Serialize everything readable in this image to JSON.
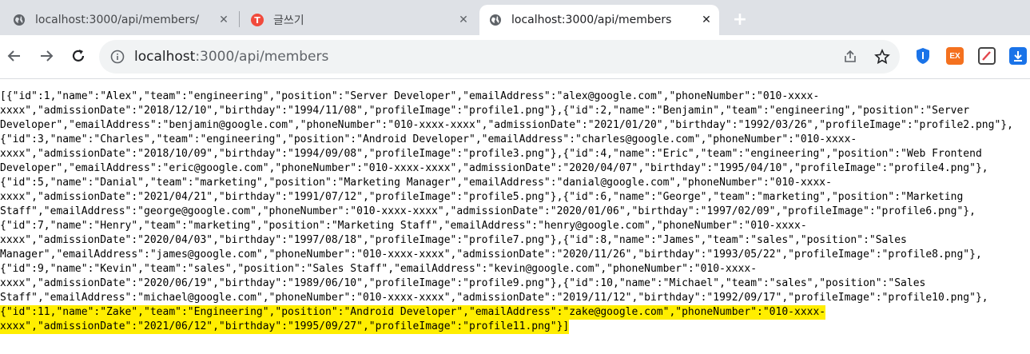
{
  "tabs": [
    {
      "title": "localhost:3000/api/members/",
      "favicon": "globe-icon",
      "active": false
    },
    {
      "title": "글쓰기",
      "favicon": "tistory-icon",
      "active": false
    },
    {
      "title": "localhost:3000/api/members",
      "favicon": "globe-icon",
      "active": true
    }
  ],
  "toolbar": {
    "url_host": "localhost",
    "url_path": ":3000/api/members"
  },
  "extensions": [
    {
      "name": "shield-extension",
      "color": "#1a73e8",
      "label": ""
    },
    {
      "name": "ex-extension",
      "color": "#f4711f",
      "label": "EX"
    },
    {
      "name": "pen-extension",
      "color": "#444444",
      "label": ""
    },
    {
      "name": "download-extension",
      "color": "#1a73e8",
      "label": ""
    }
  ],
  "colors": {
    "highlight": "#ffee00",
    "tab_strip": "#dee1e6"
  },
  "content": {
    "lines": [
      "[{\"id\":1,\"name\":\"Alex\",\"team\":\"engineering\",\"position\":\"Server Developer\",\"emailAddress\":\"alex@google.com\",\"phoneNumber\":\"010-xxxx-",
      "xxxx\",\"admissionDate\":\"2018/12/10\",\"birthday\":\"1994/11/08\",\"profileImage\":\"profile1.png\"},{\"id\":2,\"name\":\"Benjamin\",\"team\":\"engineering\",\"position\":\"Server",
      "Developer\",\"emailAddress\":\"benjamin@google.com\",\"phoneNumber\":\"010-xxxx-xxxx\",\"admissionDate\":\"2021/01/20\",\"birthday\":\"1992/03/26\",\"profileImage\":\"profile2.png\"},",
      "{\"id\":3,\"name\":\"Charles\",\"team\":\"engineering\",\"position\":\"Android Developer\",\"emailAddress\":\"charles@google.com\",\"phoneNumber\":\"010-xxxx-",
      "xxxx\",\"admissionDate\":\"2018/10/09\",\"birthday\":\"1994/09/08\",\"profileImage\":\"profile3.png\"},{\"id\":4,\"name\":\"Eric\",\"team\":\"engineering\",\"position\":\"Web Frontend",
      "Developer\",\"emailAddress\":\"eric@google.com\",\"phoneNumber\":\"010-xxxx-xxxx\",\"admissionDate\":\"2020/04/07\",\"birthday\":\"1995/04/10\",\"profileImage\":\"profile4.png\"},",
      "{\"id\":5,\"name\":\"Danial\",\"team\":\"marketing\",\"position\":\"Marketing Manager\",\"emailAddress\":\"danial@google.com\",\"phoneNumber\":\"010-xxxx-",
      "xxxx\",\"admissionDate\":\"2021/04/21\",\"birthday\":\"1991/07/12\",\"profileImage\":\"profile5.png\"},{\"id\":6,\"name\":\"George\",\"team\":\"marketing\",\"position\":\"Marketing",
      "Staff\",\"emailAddress\":\"george@google.com\",\"phoneNumber\":\"010-xxxx-xxxx\",\"admissionDate\":\"2020/01/06\",\"birthday\":\"1997/02/09\",\"profileImage\":\"profile6.png\"},",
      "{\"id\":7,\"name\":\"Henry\",\"team\":\"marketing\",\"position\":\"Marketing Staff\",\"emailAddress\":\"henry@google.com\",\"phoneNumber\":\"010-xxxx-",
      "xxxx\",\"admissionDate\":\"2020/04/03\",\"birthday\":\"1997/08/18\",\"profileImage\":\"profile7.png\"},{\"id\":8,\"name\":\"James\",\"team\":\"sales\",\"position\":\"Sales",
      "Manager\",\"emailAddress\":\"james@google.com\",\"phoneNumber\":\"010-xxxx-xxxx\",\"admissionDate\":\"2020/11/26\",\"birthday\":\"1993/05/22\",\"profileImage\":\"profile8.png\"},",
      "{\"id\":9,\"name\":\"Kevin\",\"team\":\"sales\",\"position\":\"Sales Staff\",\"emailAddress\":\"kevin@google.com\",\"phoneNumber\":\"010-xxxx-",
      "xxxx\",\"admissionDate\":\"2020/06/19\",\"birthday\":\"1989/06/10\",\"profileImage\":\"profile9.png\"},{\"id\":10,\"name\":\"Michael\",\"team\":\"sales\",\"position\":\"Sales",
      "Staff\",\"emailAddress\":\"michael@google.com\",\"phoneNumber\":\"010-xxxx-xxxx\",\"admissionDate\":\"2019/11/12\",\"birthday\":\"1992/09/17\",\"profileImage\":\"profile10.png\"},",
      "{\"id\":11,\"name\":\"Zake\",\"team\":\"Engineering\",\"position\":\"Android Developer\",\"emailAddress\":\"zake@google.com\",\"phoneNumber\":\"010-xxxx-",
      "xxxx\",\"admissionDate\":\"2021/06/12\",\"birthday\":\"1995/09/27\",\"profileImage\":\"profile11.png\"}]"
    ],
    "highlighted_lines": [
      15,
      16
    ]
  }
}
